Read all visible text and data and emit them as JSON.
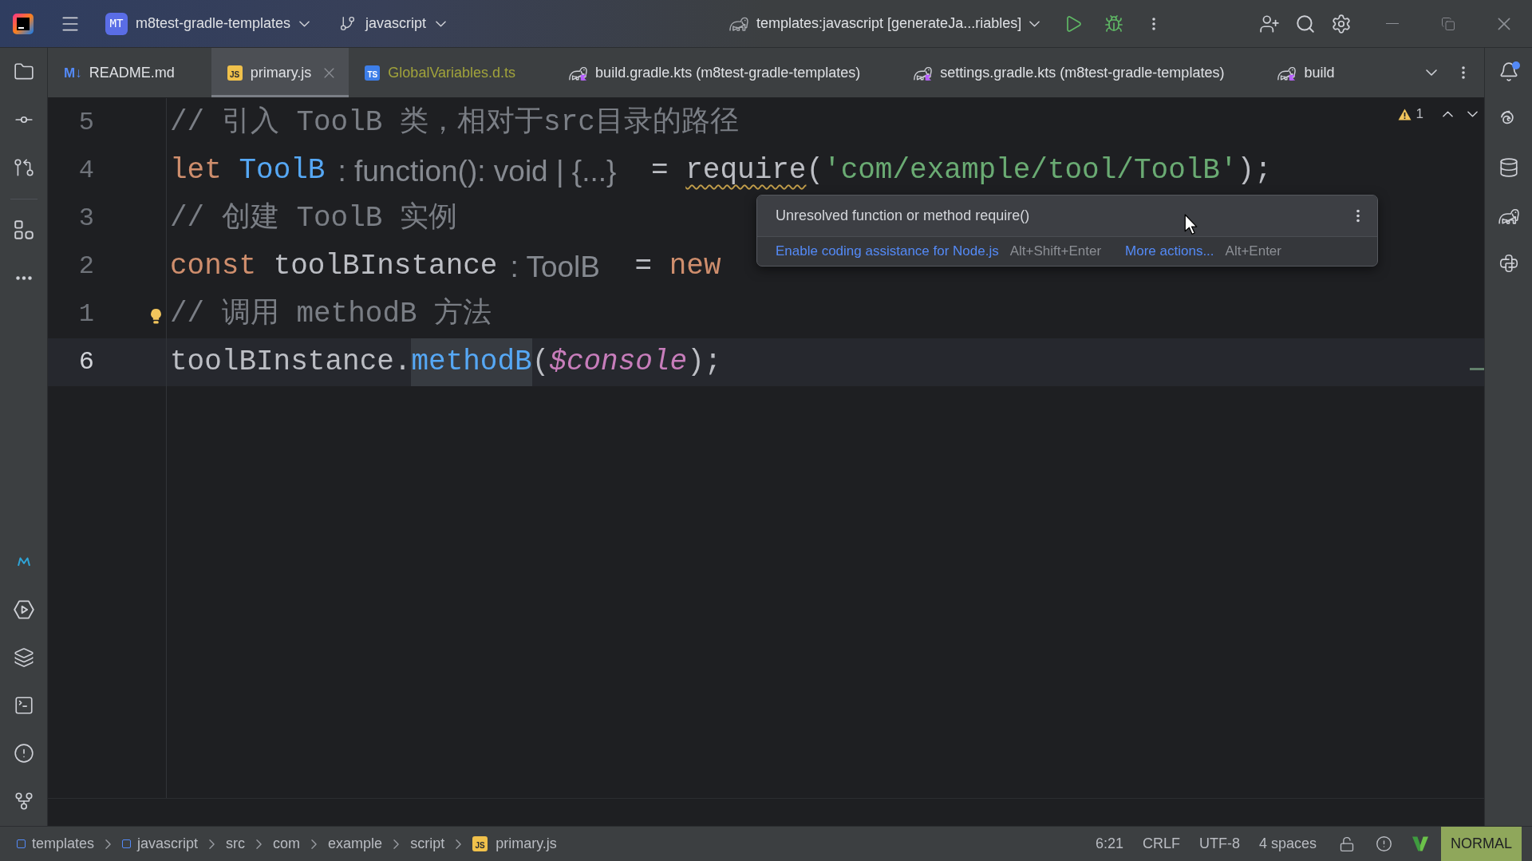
{
  "title_bar": {
    "project_badge": "MT",
    "project": "m8test-gradle-templates",
    "branch": "javascript",
    "run_configuration": "templates:javascript [generateJa...riables]"
  },
  "tabs": [
    {
      "kind": "markdown",
      "badge": "M↓",
      "label": "README.md",
      "selected": false,
      "color": "#dfe1e5"
    },
    {
      "kind": "javascript",
      "badge": "JS",
      "label": "primary.js",
      "selected": true,
      "color": "#dfe1e5"
    },
    {
      "kind": "typescript",
      "badge": "TS",
      "label": "GlobalVariables.d.ts",
      "selected": false,
      "color": "#a1a33b"
    },
    {
      "kind": "gradle_kts",
      "label": "build.gradle.kts (m8test-gradle-templates)",
      "selected": false,
      "color": "#dfe1e5"
    },
    {
      "kind": "gradle_kts",
      "label": "settings.gradle.kts (m8test-gradle-templates)",
      "selected": false,
      "color": "#dfe1e5"
    },
    {
      "kind": "gradle_kts",
      "label": "build",
      "selected": false,
      "color": "#dfe1e5"
    }
  ],
  "notifications": {
    "unread": true
  },
  "editor": {
    "warnings": "1",
    "lines": [
      {
        "number": "5",
        "current": false,
        "bulb": false,
        "segments": [
          {
            "kind": "comment",
            "text": "// 引入 ToolB 类，相对于src目录的路径",
            "highlighted": false
          }
        ]
      },
      {
        "number": "4",
        "current": false,
        "bulb": false,
        "segments": [
          {
            "kind": "keyword",
            "text": "let ",
            "highlighted": false
          },
          {
            "kind": "function",
            "text": "ToolB",
            "highlighted": false
          },
          {
            "kind": "hint",
            "text": ": function(): void | {...}",
            "highlighted": false
          },
          {
            "kind": "plain",
            "text": " = ",
            "highlighted": false
          },
          {
            "kind": "unresolved",
            "text": "require",
            "highlighted": false
          },
          {
            "kind": "plain",
            "text": "(",
            "highlighted": false
          },
          {
            "kind": "string",
            "text": "'com/example/tool/ToolB'",
            "highlighted": false
          },
          {
            "kind": "plain",
            "text": ");",
            "highlighted": false
          }
        ]
      },
      {
        "number": "3",
        "current": false,
        "bulb": false,
        "segments": [
          {
            "kind": "comment",
            "text": "// 创建 ToolB 实例",
            "highlighted": false
          }
        ]
      },
      {
        "number": "2",
        "current": false,
        "bulb": false,
        "segments": [
          {
            "kind": "keyword",
            "text": "const ",
            "highlighted": false
          },
          {
            "kind": "plain",
            "text": "toolBInstance",
            "highlighted": false
          },
          {
            "kind": "hint",
            "text": ": ToolB",
            "highlighted": false
          },
          {
            "kind": "plain",
            "text": " = ",
            "highlighted": false
          },
          {
            "kind": "keyword",
            "text": "new ",
            "highlighted": false
          }
        ]
      },
      {
        "number": "1",
        "current": false,
        "bulb": true,
        "segments": [
          {
            "kind": "comment",
            "text": "// 调用 methodB 方法",
            "highlighted": false
          }
        ]
      },
      {
        "number": "6",
        "current": true,
        "bulb": false,
        "segments": [
          {
            "kind": "plain",
            "text": "toolBInstance.",
            "highlighted": false
          },
          {
            "kind": "function",
            "text": "methodB",
            "highlighted": true
          },
          {
            "kind": "plain",
            "text": "(",
            "highlighted": false
          },
          {
            "kind": "global",
            "text": "$console",
            "highlighted": false
          },
          {
            "kind": "plain",
            "text": ");",
            "highlighted": false
          }
        ]
      }
    ]
  },
  "popup": {
    "message": "Unresolved function or method require()",
    "actions": [
      {
        "label": "Enable coding assistance for Node.js",
        "shortcut": "Alt+Shift+Enter"
      },
      {
        "label": "More actions...",
        "shortcut": "Alt+Enter"
      }
    ]
  },
  "breadcrumbs": [
    {
      "kind": "module",
      "label": "templates"
    },
    {
      "kind": "module",
      "label": "javascript"
    },
    {
      "kind": "folder",
      "label": "src"
    },
    {
      "kind": "folder",
      "label": "com"
    },
    {
      "kind": "folder",
      "label": "example"
    },
    {
      "kind": "folder",
      "label": "script"
    },
    {
      "kind": "file",
      "badge": "JS",
      "label": "primary.js"
    }
  ],
  "status_bar": {
    "position": "6:21",
    "line_separator": "CRLF",
    "encoding": "UTF-8",
    "indent": "4 spaces",
    "vim_mode": "NORMAL"
  }
}
